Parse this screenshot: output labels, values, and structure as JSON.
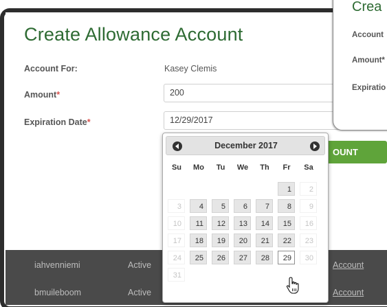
{
  "modal": {
    "title": "Create Allowance Account",
    "account_for_label": "Account For:",
    "account_for_value": "Kasey Clemis",
    "amount_label": "Amount",
    "amount_value": "200",
    "expiration_label": "Expiration Date",
    "expiration_value": "12/29/2017",
    "required_mark": "*",
    "create_button_label": "OUNT"
  },
  "back_card": {
    "title": "Crea",
    "label_account": "Account",
    "label_amount": "Amount*",
    "label_expiration": "Expiratio"
  },
  "datepicker": {
    "month_title": "December 2017",
    "weekdays": [
      "Su",
      "Mo",
      "Tu",
      "We",
      "Th",
      "Fr",
      "Sa"
    ],
    "selected_day": "29"
  },
  "table_rows": [
    {
      "user": "iahvenniemi",
      "status": "Active",
      "action": "Account"
    },
    {
      "user": "bmuileboom",
      "status": "Active",
      "action": "Account"
    }
  ],
  "colors": {
    "title_green": "#2e6b33",
    "button_green": "#5fa43a",
    "required_red": "#d9534f"
  }
}
